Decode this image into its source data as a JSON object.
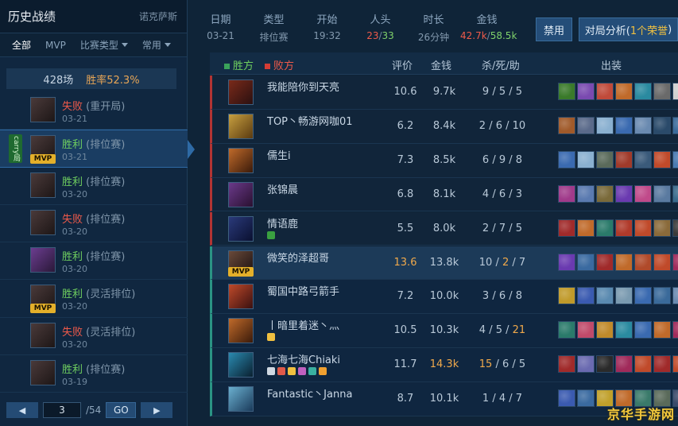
{
  "left": {
    "title": "历史战绩",
    "player": "诺克萨斯",
    "tabs": [
      "全部",
      "MVP",
      "比赛类型",
      "常用"
    ],
    "summary": {
      "count": "428场",
      "winrate": "胜率52.3%"
    },
    "matches": [
      {
        "result": "失败",
        "mode": "(重开局)",
        "date": "03-21",
        "win": false,
        "mvp": false,
        "selected": false,
        "carry": false,
        "avatar": "dark"
      },
      {
        "result": "胜利",
        "mode": "(排位赛)",
        "date": "03-21",
        "win": true,
        "mvp": true,
        "selected": true,
        "carry": true,
        "avatar": "dark"
      },
      {
        "result": "胜利",
        "mode": "(排位赛)",
        "date": "03-20",
        "win": true,
        "mvp": false,
        "selected": false,
        "carry": false,
        "avatar": "dark"
      },
      {
        "result": "失败",
        "mode": "(排位赛)",
        "date": "03-20",
        "win": false,
        "mvp": false,
        "selected": false,
        "carry": false,
        "avatar": "dark"
      },
      {
        "result": "胜利",
        "mode": "(排位赛)",
        "date": "03-20",
        "win": true,
        "mvp": false,
        "selected": false,
        "carry": false,
        "avatar": "purple"
      },
      {
        "result": "胜利",
        "mode": "(灵活排位)",
        "date": "03-20",
        "win": true,
        "mvp": true,
        "selected": false,
        "carry": false,
        "avatar": "dark"
      },
      {
        "result": "失败",
        "mode": "(灵活排位)",
        "date": "03-20",
        "win": false,
        "mvp": false,
        "selected": false,
        "carry": false,
        "avatar": "dark"
      },
      {
        "result": "胜利",
        "mode": "(排位赛)",
        "date": "03-19",
        "win": true,
        "mvp": false,
        "selected": false,
        "carry": false,
        "avatar": "dark"
      }
    ],
    "carry_label": "carry局",
    "mvp_label": "MVP",
    "pager": {
      "page": "3",
      "total": "/54",
      "go": "GO",
      "prev": "◀",
      "next": "▶"
    }
  },
  "info": [
    {
      "k": "日期",
      "v": "03-21"
    },
    {
      "k": "类型",
      "v": "排位赛"
    },
    {
      "k": "开始",
      "v": "19:32"
    },
    {
      "k": "人头",
      "v1": "23",
      "sep": "/",
      "v2": "33"
    },
    {
      "k": "时长",
      "v": "26分钟"
    },
    {
      "k": "金钱",
      "v1": "42.7k",
      "sep": "/",
      "v2": "58.5k"
    }
  ],
  "buttons": {
    "ban": "禁用",
    "analysis_pre": "对局分析(",
    "analysis_hl": "1个荣誉",
    "analysis_post": ")"
  },
  "table": {
    "legend_win": "胜方",
    "legend_lose": "败方",
    "headers": {
      "rating": "评价",
      "gold": "金钱",
      "kda": "杀/死/助",
      "items": "出装"
    }
  },
  "players": [
    {
      "name": "我能陪你到天亮",
      "rating": "10.6",
      "gold": "9.7k",
      "k": "9",
      "d": "5",
      "a": "5",
      "team": "red",
      "badges": [],
      "avatar": [
        "#7a2a1a",
        "#2a1010"
      ],
      "items": [
        "#3a7a2a",
        "#7a4ab0",
        "#c04a3a",
        "#c06a2a",
        "#2a8aa0",
        "#6a6a6a",
        "#d0d0d0"
      ]
    },
    {
      "name": "TOP丶畅游网咖01",
      "rating": "6.2",
      "gold": "8.4k",
      "k": "2",
      "d": "6",
      "a": "10",
      "team": "red",
      "badges": [],
      "avatar": [
        "#c8a040",
        "#5a3a10"
      ],
      "items": [
        "#a05a2a",
        "#5a6a8a",
        "#8ab0d0",
        "#3a6ab0",
        "#6a8ab0",
        "#2a4a6a",
        "#3a6a9a"
      ]
    },
    {
      "name": "儒生i",
      "rating": "7.3",
      "gold": "8.5k",
      "k": "6",
      "d": "9",
      "a": "8",
      "team": "red",
      "badges": [],
      "avatar": [
        "#c06a2a",
        "#3a1a0a"
      ],
      "items": [
        "#3a6ab0",
        "#8ab0d0",
        "#5a6a5a",
        "#a03a2a",
        "#3a5a7a",
        "#c04a2a",
        "#4a7ab0"
      ]
    },
    {
      "name": "张锦晨",
      "rating": "6.8",
      "gold": "8.1k",
      "k": "4",
      "d": "6",
      "a": "3",
      "team": "red",
      "badges": [],
      "avatar": [
        "#6a3a8a",
        "#2a1030"
      ],
      "items": [
        "#a03a8a",
        "#5a7ab0",
        "#7a6a3a",
        "#6a3ab0",
        "#c04a8a",
        "#5a7aa0",
        "#3a6a8a"
      ]
    },
    {
      "name": "情语鹿",
      "rating": "5.5",
      "gold": "8.0k",
      "k": "2",
      "d": "7",
      "a": "5",
      "team": "red",
      "badges": [
        "#3aa040"
      ],
      "avatar": [
        "#2a3a7a",
        "#0a1030"
      ],
      "items": [
        "#a02a2a",
        "#c06a2a",
        "#2a7a6a",
        "#b03a2a",
        "#c04a2a",
        "#8a6a3a",
        "#3a3a3a"
      ]
    },
    {
      "name": "微笑的泽超哥",
      "rating": "13.6",
      "gold": "13.8k",
      "k": "10",
      "d": "2",
      "a": "7",
      "team": "blue",
      "me": true,
      "mvp": true,
      "badges": [],
      "avatar": [
        "#6a4a3a",
        "#1a1010"
      ],
      "items": [
        "#6a3ab0",
        "#3a6aa0",
        "#a02a2a",
        "#c06a2a",
        "#b04a2a",
        "#c04a2a",
        "#a02a5a"
      ]
    },
    {
      "name": "蜀国中路弓箭手",
      "rating": "7.2",
      "gold": "10.0k",
      "k": "3",
      "d": "6",
      "a": "8",
      "team": "blue",
      "badges": [],
      "avatar": [
        "#c04a2a",
        "#3a1010"
      ],
      "items": [
        "#c09a2a",
        "#3a5ab0",
        "#5a8ab0",
        "#7a9ab0",
        "#3a6ab0",
        "#3a6a9a",
        "#6a8ab0"
      ]
    },
    {
      "name": "丨暗里着迷丶灬",
      "rating": "10.5",
      "gold": "10.3k",
      "k": "4",
      "d": "5",
      "a": "21",
      "team": "blue",
      "badges": [
        "#f0c040"
      ],
      "avatar": [
        "#c06a2a",
        "#3a1a0a"
      ],
      "items": [
        "#2a7a6a",
        "#c04a6a",
        "#c08a2a",
        "#2a8aa0",
        "#3a6ab0",
        "#c06a2a",
        "#a02a5a"
      ]
    },
    {
      "name": "七海七海Chiaki",
      "rating": "11.7",
      "gold": "14.3k",
      "k": "15",
      "d": "6",
      "a": "5",
      "team": "blue",
      "badges": [
        "#cfd8e2",
        "#e05a4a",
        "#f0c040",
        "#c060c0",
        "#3ab0a0",
        "#f0a030"
      ],
      "avatar": [
        "#2a8ab0",
        "#0a2030"
      ],
      "items": [
        "#a02a2a",
        "#6a6ab0",
        "#2a2a2a",
        "#a02a5a",
        "#c04a2a",
        "#a02a2a",
        "#c04a2a"
      ]
    },
    {
      "name": "Fantastic丶Janna",
      "rating": "8.7",
      "gold": "10.1k",
      "k": "1",
      "d": "4",
      "a": "7",
      "team": "blue",
      "badges": [],
      "avatar": [
        "#6ab0d0",
        "#1a3a5a"
      ],
      "items": [
        "#3a5ab0",
        "#3a6aa0",
        "#c0a02a",
        "#c06a2a",
        "#3a7a6a",
        "#5a6a5a",
        "#3a4a6a"
      ]
    }
  ],
  "watermark": "京华手游网"
}
